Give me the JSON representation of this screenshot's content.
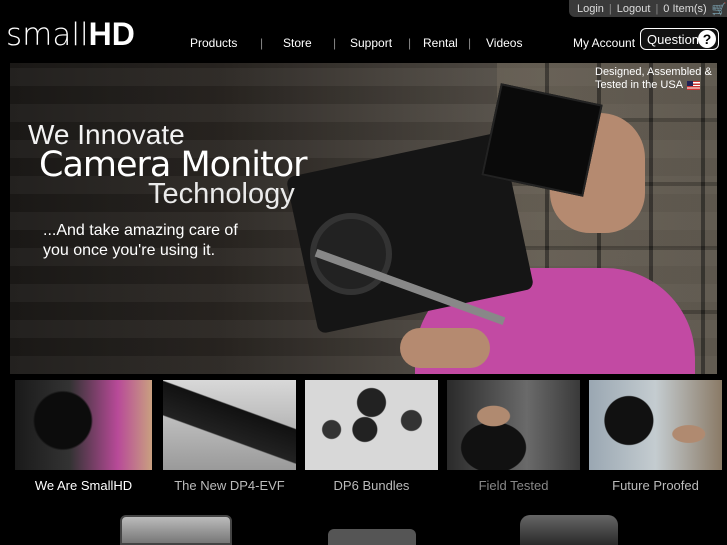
{
  "header": {
    "logo_small": "small",
    "logo_hd": "HD",
    "top_links": [
      "Login",
      "Logout",
      "0 Item(s)"
    ],
    "nav": [
      "Products",
      "Store",
      "Support",
      "Rental",
      "Videos"
    ],
    "account": "My Account",
    "questions": "Questions",
    "questions_icon": "?"
  },
  "hero": {
    "line1": "We Innovate",
    "line2": "Camera Monitor",
    "line3": "Technology",
    "sub1": "...And take amazing care of",
    "sub2": "you once you're using it.",
    "usa1": "Designed, Assembled &",
    "usa2": "Tested in the USA"
  },
  "thumbs": [
    {
      "label": "We Are SmallHD",
      "label_color": "#ffffff"
    },
    {
      "label": "The New DP4-EVF",
      "label_color": "#bbbbbb"
    },
    {
      "label": "DP6 Bundles",
      "label_color": "#bbbbbb"
    },
    {
      "label": "Field Tested",
      "label_color": "#888888"
    },
    {
      "label": "Future Proofed",
      "label_color": "#bbbbbb"
    }
  ],
  "colors": {
    "shirt": "#c24aa3",
    "background": "#000000"
  }
}
